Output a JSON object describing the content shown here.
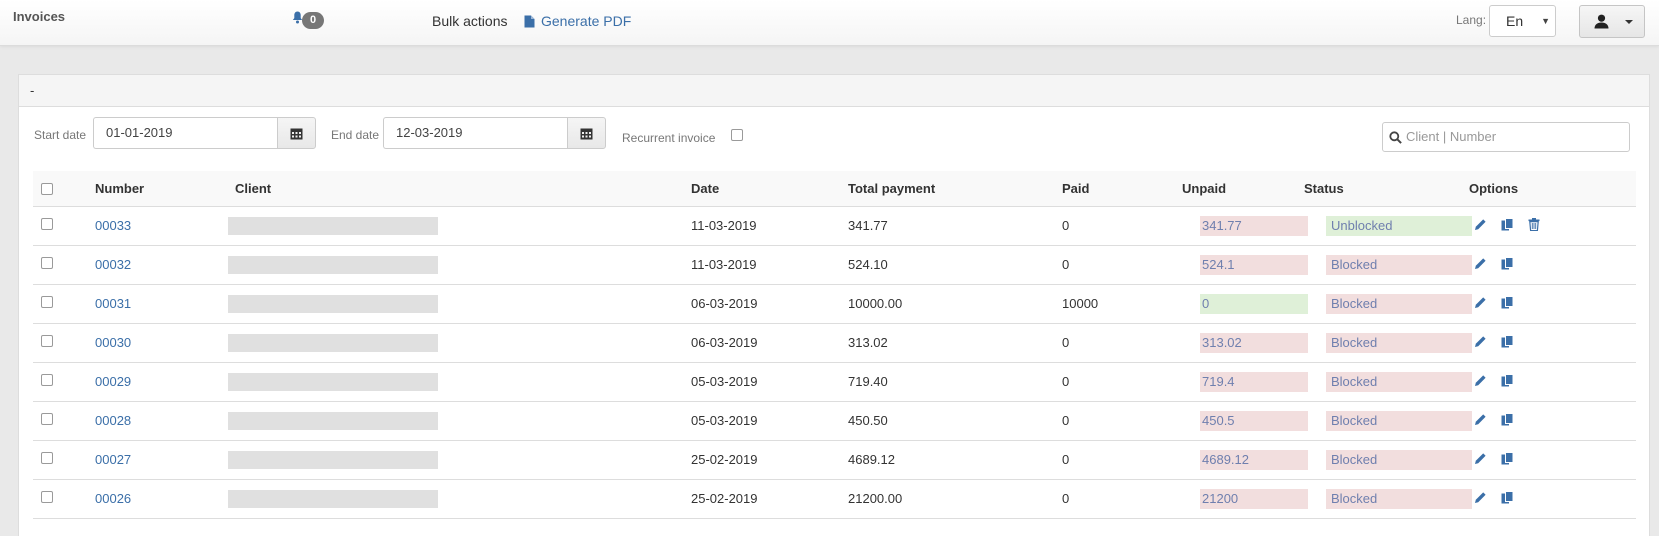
{
  "app": {
    "title": "Invoices",
    "notifications_count": "0",
    "bulk_actions_label": "Bulk actions",
    "generate_pdf_label": "Generate PDF",
    "lang_label": "Lang:",
    "lang_value": "En"
  },
  "panel": {
    "heading": "-"
  },
  "filters": {
    "start_date_label": "Start date",
    "start_date_value": "01-01-2019",
    "end_date_label": "End date",
    "end_date_value": "12-03-2019",
    "recurrent_label": "Recurrent invoice",
    "recurrent_checked": false,
    "search_placeholder": "Client | Number"
  },
  "table": {
    "headers": {
      "number": "Number",
      "client": "Client",
      "date": "Date",
      "total": "Total payment",
      "paid": "Paid",
      "unpaid": "Unpaid",
      "status": "Status",
      "options": "Options"
    },
    "rows": [
      {
        "number": "00033",
        "date": "11-03-2019",
        "total": "341.77",
        "paid": "0",
        "unpaid": "341.77",
        "status": "Unblocked",
        "unpaid_state": "red",
        "status_state": "green",
        "can_delete": true
      },
      {
        "number": "00032",
        "date": "11-03-2019",
        "total": "524.10",
        "paid": "0",
        "unpaid": "524.1",
        "status": "Blocked",
        "unpaid_state": "red",
        "status_state": "red",
        "can_delete": false
      },
      {
        "number": "00031",
        "date": "06-03-2019",
        "total": "10000.00",
        "paid": "10000",
        "unpaid": "0",
        "status": "Blocked",
        "unpaid_state": "green",
        "status_state": "red",
        "can_delete": false
      },
      {
        "number": "00030",
        "date": "06-03-2019",
        "total": "313.02",
        "paid": "0",
        "unpaid": "313.02",
        "status": "Blocked",
        "unpaid_state": "red",
        "status_state": "red",
        "can_delete": false
      },
      {
        "number": "00029",
        "date": "05-03-2019",
        "total": "719.40",
        "paid": "0",
        "unpaid": "719.4",
        "status": "Blocked",
        "unpaid_state": "red",
        "status_state": "red",
        "can_delete": false
      },
      {
        "number": "00028",
        "date": "05-03-2019",
        "total": "450.50",
        "paid": "0",
        "unpaid": "450.5",
        "status": "Blocked",
        "unpaid_state": "red",
        "status_state": "red",
        "can_delete": false
      },
      {
        "number": "00027",
        "date": "25-02-2019",
        "total": "4689.12",
        "paid": "0",
        "unpaid": "4689.12",
        "status": "Blocked",
        "unpaid_state": "red",
        "status_state": "red",
        "can_delete": false
      },
      {
        "number": "00026",
        "date": "25-02-2019",
        "total": "21200.00",
        "paid": "0",
        "unpaid": "21200",
        "status": "Blocked",
        "unpaid_state": "red",
        "status_state": "red",
        "can_delete": false
      }
    ]
  },
  "icons": {
    "bell": "bell-icon",
    "pdf": "file-icon",
    "user": "user-icon",
    "calendar": "calendar-icon",
    "search": "search-icon",
    "edit": "pencil-icon",
    "copy": "copy-icon",
    "delete": "trash-icon"
  },
  "colors": {
    "link": "#3b6fa8",
    "unpaid_red_bg": "#f2dede",
    "paid_green_bg": "#dff0d8",
    "pill_text": "#6f7fae"
  }
}
